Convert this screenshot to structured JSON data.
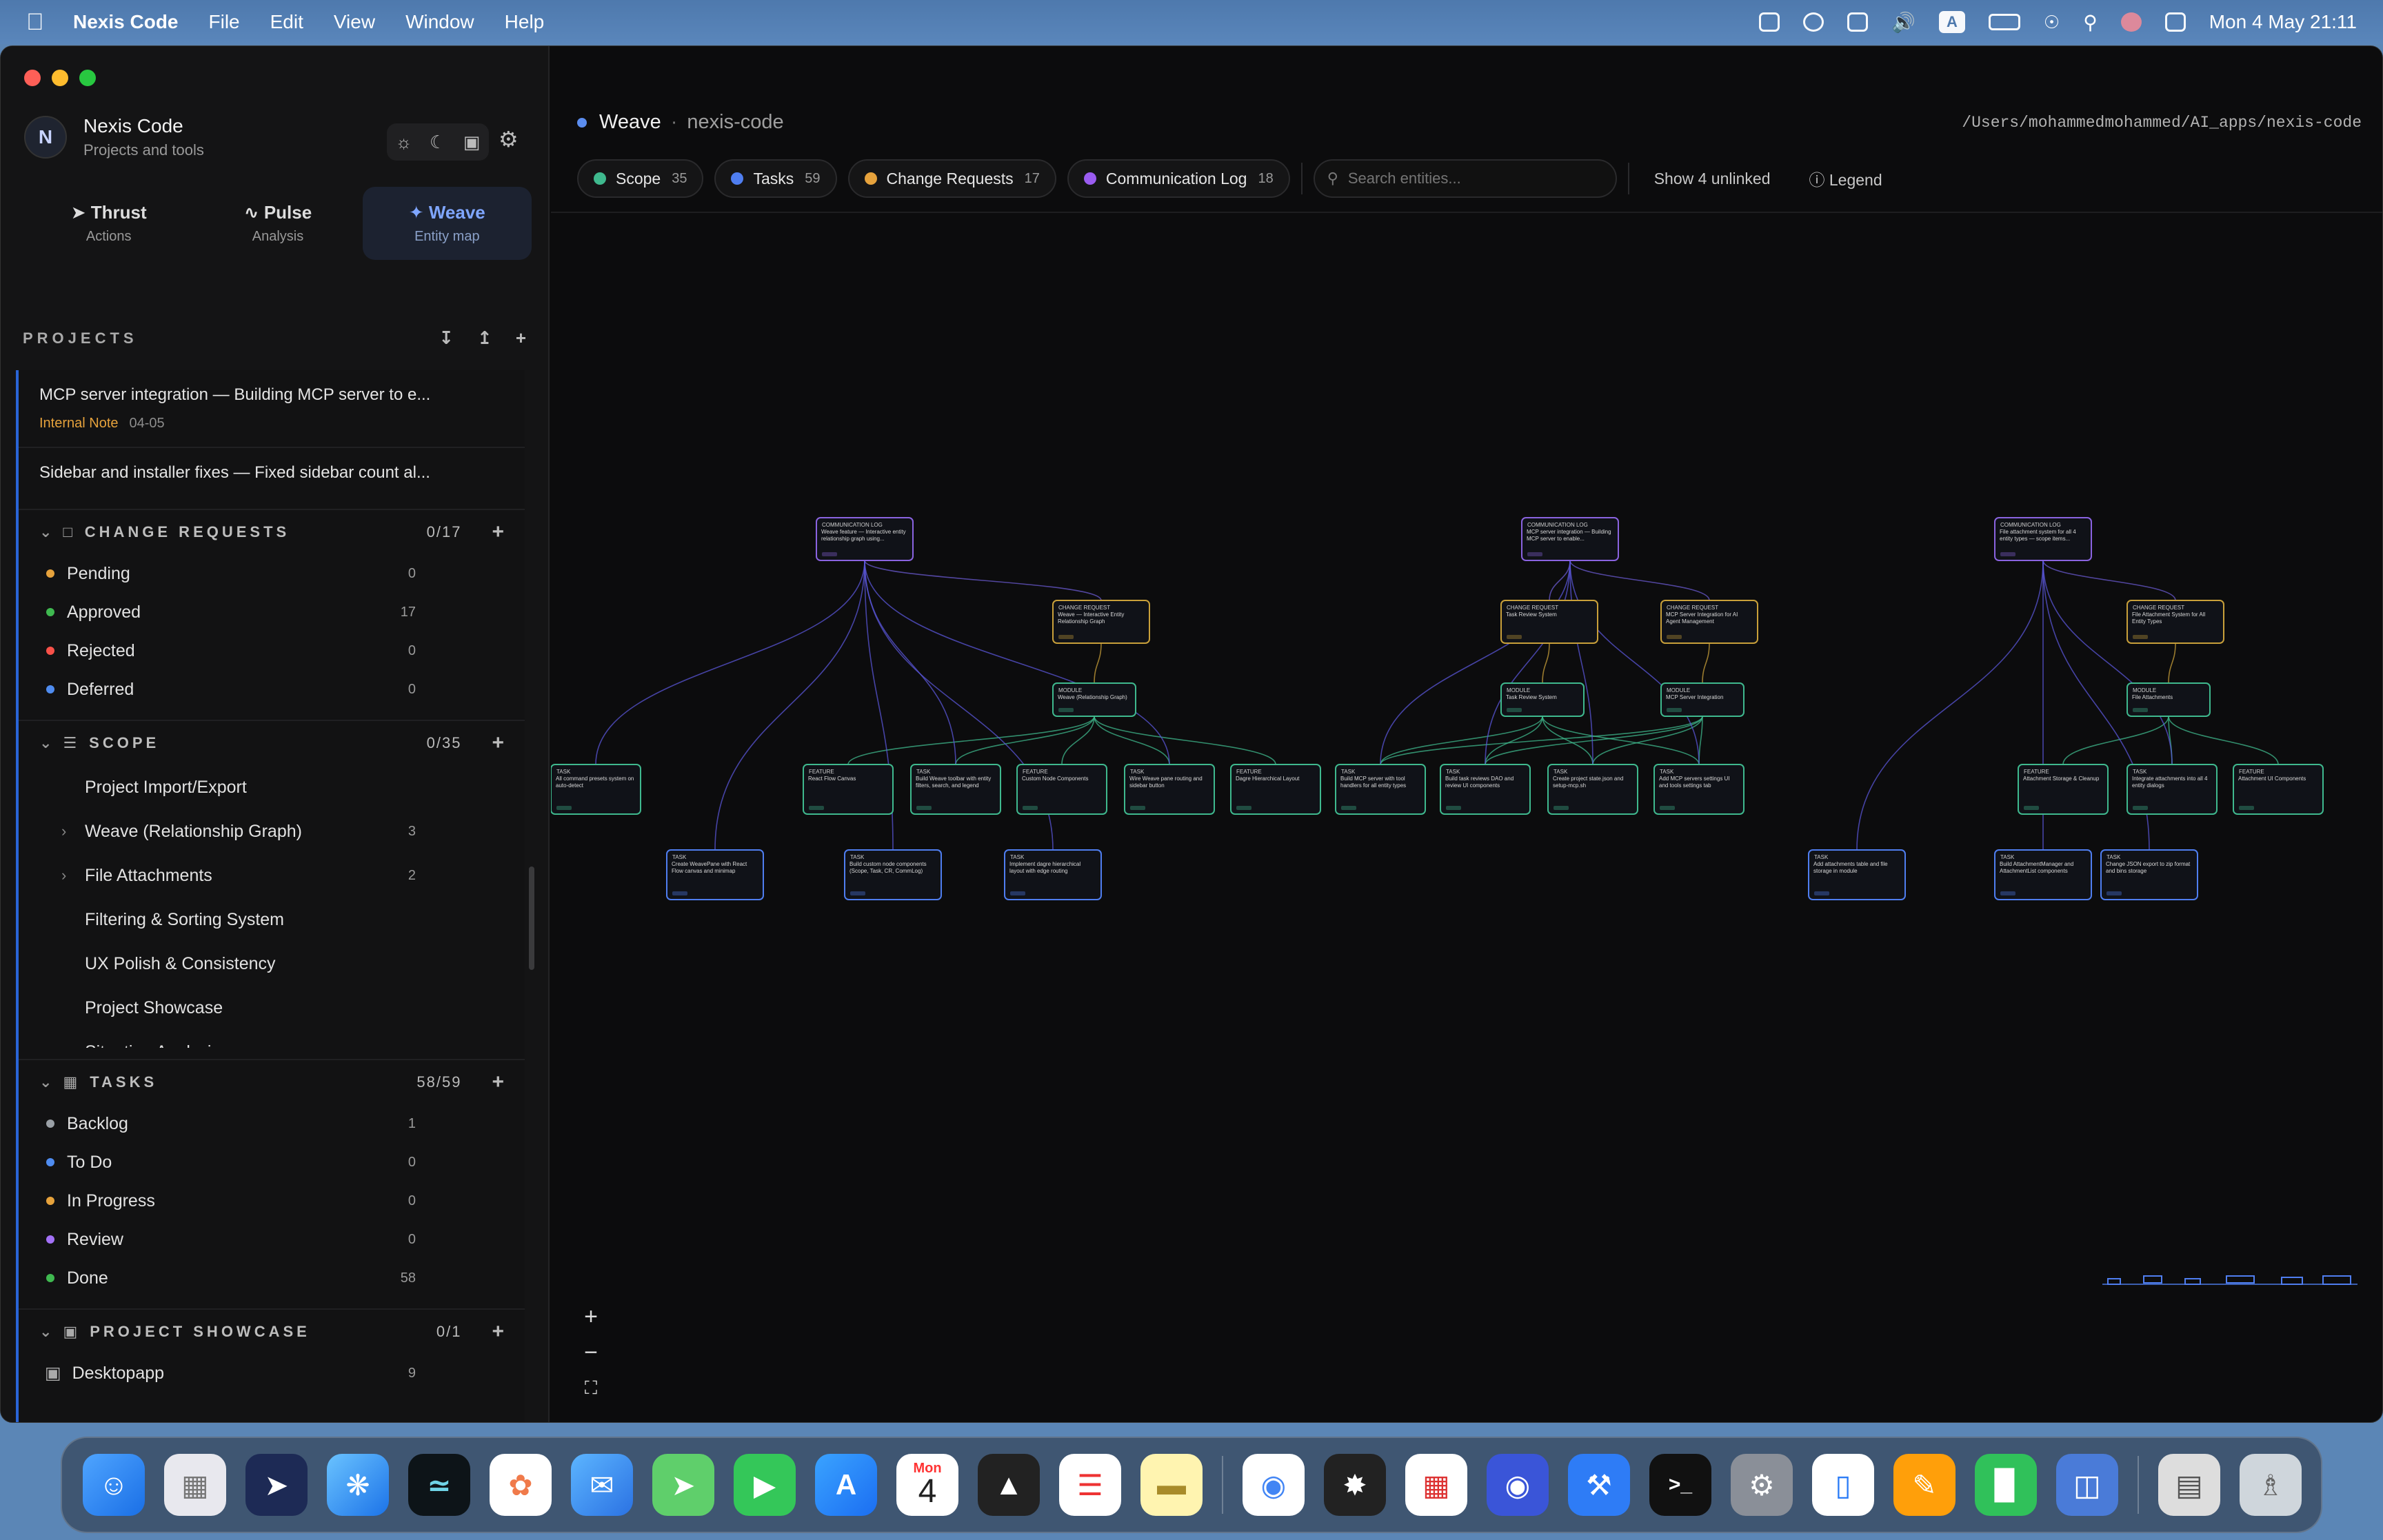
{
  "menubar": {
    "app": "Nexis Code",
    "items": [
      "File",
      "Edit",
      "View",
      "Window",
      "Help"
    ],
    "status_letter": "A",
    "clock": "Mon 4 May  21:11"
  },
  "sidebar": {
    "avatar": "N",
    "title": "Nexis Code",
    "subtitle": "Projects and tools",
    "modes": [
      {
        "label": "Thrust",
        "sub": "Actions"
      },
      {
        "label": "Pulse",
        "sub": "Analysis"
      },
      {
        "label": "Weave",
        "sub": "Entity map"
      }
    ],
    "projects_label": "PROJECTS",
    "notes": [
      {
        "title": "MCP server integration — Building MCP server to e...",
        "tag": "Internal Note",
        "date": "04-05"
      },
      {
        "title": "Sidebar and installer fixes — Fixed sidebar count al..."
      }
    ],
    "change_requests": {
      "label": "CHANGE REQUESTS",
      "count": "0/17",
      "items": [
        {
          "label": "Pending",
          "count": "0",
          "color": "#e6a23c"
        },
        {
          "label": "Approved",
          "count": "17",
          "color": "#3fb950"
        },
        {
          "label": "Rejected",
          "count": "0",
          "color": "#f85149"
        },
        {
          "label": "Deferred",
          "count": "0",
          "color": "#4f8cf0"
        }
      ]
    },
    "scope": {
      "label": "SCOPE",
      "count": "0/35",
      "items": [
        {
          "label": "Project Import/Export",
          "count": "",
          "arrow": ""
        },
        {
          "label": "Weave (Relationship Graph)",
          "count": "3",
          "arrow": "›"
        },
        {
          "label": "File Attachments",
          "count": "2",
          "arrow": "›"
        },
        {
          "label": "Filtering & Sorting System",
          "count": "",
          "arrow": ""
        },
        {
          "label": "UX Polish & Consistency",
          "count": "",
          "arrow": ""
        },
        {
          "label": "Project Showcase",
          "count": "",
          "arrow": ""
        },
        {
          "label": "Situation Analysis",
          "count": "",
          "arrow": ""
        }
      ]
    },
    "tasks": {
      "label": "TASKS",
      "count": "58/59",
      "items": [
        {
          "label": "Backlog",
          "count": "1",
          "color": "#9aa0a6"
        },
        {
          "label": "To Do",
          "count": "0",
          "color": "#4f8cf0"
        },
        {
          "label": "In Progress",
          "count": "0",
          "color": "#e6a23c"
        },
        {
          "label": "Review",
          "count": "0",
          "color": "#a371f7"
        },
        {
          "label": "Done",
          "count": "58",
          "color": "#3fb950"
        }
      ]
    },
    "showcase": {
      "label": "PROJECT SHOWCASE",
      "count": "0/1",
      "items": [
        {
          "label": "Desktopapp",
          "count": "9"
        }
      ]
    }
  },
  "main": {
    "title": "Weave",
    "project": "nexis-code",
    "path": "/Users/mohammedmohammed/AI_apps/nexis-code",
    "chips": [
      {
        "label": "Scope",
        "count": "35",
        "color": "#3fb98e"
      },
      {
        "label": "Tasks",
        "count": "59",
        "color": "#4f7ef0"
      },
      {
        "label": "Change Requests",
        "count": "17",
        "color": "#e6a23c"
      },
      {
        "label": "Communication Log",
        "count": "18",
        "color": "#9a5cf0"
      }
    ],
    "search_placeholder": "Search entities...",
    "show_unlinked": "Show 4 unlinked",
    "legend": "Legend",
    "zoom": {
      "in": "+",
      "out": "−",
      "fit": "⛶"
    }
  },
  "graph": {
    "comm": [
      {
        "type": "COMMUNICATION LOG",
        "title": "Weave feature — Interactive entity relationship graph using..."
      },
      {
        "type": "COMMUNICATION LOG",
        "title": "MCP server integration — Building MCP server to enable..."
      },
      {
        "type": "COMMUNICATION LOG",
        "title": "File attachment system for all 4 entity types — scope items..."
      }
    ],
    "cr": [
      {
        "type": "CHANGE REQUEST",
        "title": "Weave — Interactive Entity Relationship Graph"
      },
      {
        "type": "CHANGE REQUEST",
        "title": "Task Review System"
      },
      {
        "type": "CHANGE REQUEST",
        "title": "MCP Server Integration for AI Agent Management"
      },
      {
        "type": "CHANGE REQUEST",
        "title": "File Attachment System for All Entity Types"
      }
    ],
    "scope": [
      {
        "type": "MODULE",
        "title": "Weave (Relationship Graph)"
      },
      {
        "type": "MODULE",
        "title": "Task Review System"
      },
      {
        "type": "MODULE",
        "title": "MCP Server Integration"
      },
      {
        "type": "MODULE",
        "title": "File Attachments"
      }
    ],
    "features": [
      {
        "type": "TASK",
        "title": "All command presets system on auto-detect"
      },
      {
        "type": "FEATURE",
        "title": "React Flow Canvas"
      },
      {
        "type": "TASK",
        "title": "Build Weave toolbar with entity filters, search, and legend"
      },
      {
        "type": "FEATURE",
        "title": "Custom Node Components"
      },
      {
        "type": "TASK",
        "title": "Wire Weave pane routing and sidebar button"
      },
      {
        "type": "FEATURE",
        "title": "Dagre Hierarchical Layout"
      },
      {
        "type": "TASK",
        "title": "Build MCP server with tool handlers for all entity types"
      },
      {
        "type": "TASK",
        "title": "Build task reviews DAO and review UI components"
      },
      {
        "type": "TASK",
        "title": "Create project state.json and setup-mcp.sh"
      },
      {
        "type": "TASK",
        "title": "Add MCP servers settings UI and tools settings tab"
      },
      {
        "type": "FEATURE",
        "title": "Attachment Storage & Cleanup"
      },
      {
        "type": "TASK",
        "title": "Integrate attachments into all 4 entity dialogs"
      },
      {
        "type": "FEATURE",
        "title": "Attachment UI Components"
      }
    ],
    "tasks": [
      {
        "type": "TASK",
        "title": "Create WeavePane with React Flow canvas and minimap"
      },
      {
        "type": "TASK",
        "title": "Build custom node components (Scope, Task, CR, CommLog)"
      },
      {
        "type": "TASK",
        "title": "Implement dagre hierarchical layout with edge routing"
      },
      {
        "type": "TASK",
        "title": "Add attachments table and file storage in module"
      },
      {
        "type": "TASK",
        "title": "Build AttachmentManager and AttachmentList components"
      },
      {
        "type": "TASK",
        "title": "Change JSON export to zip format and bins storage"
      }
    ]
  },
  "dock": {
    "calendar_month": "Mon",
    "calendar_day": "4",
    "terminal": ">_"
  }
}
